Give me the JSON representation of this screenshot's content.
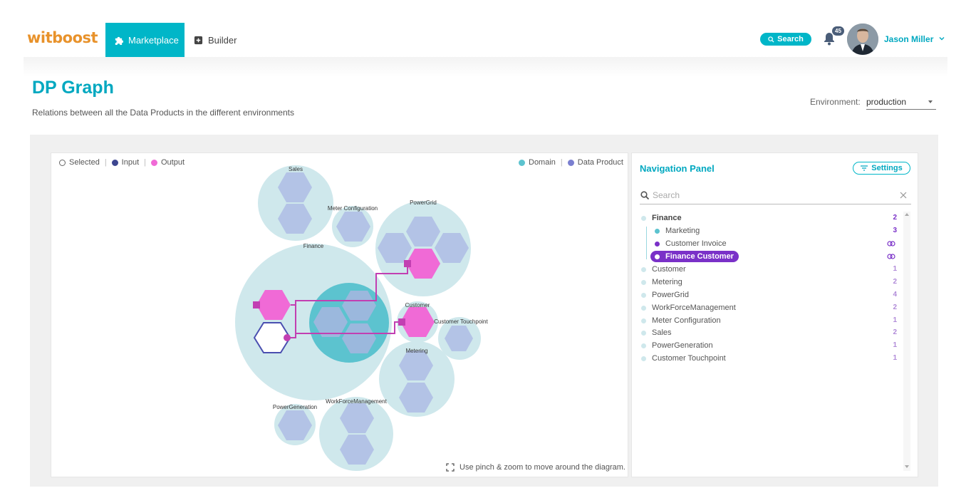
{
  "app": {
    "logo": "witboost",
    "nav": {
      "marketplace": "Marketplace",
      "builder": "Builder"
    },
    "search_button": "Search",
    "notifications_count": "45",
    "user": {
      "name": "Jason Miller"
    }
  },
  "page": {
    "title": "DP Graph",
    "subtitle": "Relations between all the Data Products in the different environments",
    "environment_label": "Environment:",
    "environment_value": "production"
  },
  "graph": {
    "legend_left": {
      "selected": "Selected",
      "input": "Input",
      "output": "Output"
    },
    "legend_right": {
      "domain": "Domain",
      "data_product": "Data Product"
    },
    "domains": {
      "sales": "Sales",
      "meter_configuration": "Meter Configuration",
      "powergrid": "PowerGrid",
      "finance": "Finance",
      "customer": "Customer",
      "customer_touchpoint": "Customer Touchpoint",
      "metering": "Metering",
      "powergeneration": "PowerGeneration",
      "workforcemanagement": "WorkForceManagement"
    },
    "hint": "Use pinch & zoom to move around the diagram.",
    "colors": {
      "domain": "#cfe8ec",
      "domain_selected": "#5cc3cf",
      "data_product": "#b3c3e6",
      "output": "#f06ad6",
      "input": "#4a4fb0",
      "edge": "#c23fb2"
    }
  },
  "navigation_panel": {
    "title": "Navigation Panel",
    "settings_label": "Settings",
    "search_placeholder": "Search",
    "items": [
      {
        "label": "Finance",
        "count": "2"
      },
      {
        "label": "Marketing",
        "count": "3"
      },
      {
        "label": "Customer Invoice",
        "count": ""
      },
      {
        "label": "Finance Customer",
        "count": ""
      },
      {
        "label": "Customer",
        "count": "1"
      },
      {
        "label": "Metering",
        "count": "2"
      },
      {
        "label": "PowerGrid",
        "count": "4"
      },
      {
        "label": "WorkForceManagement",
        "count": "2"
      },
      {
        "label": "Meter Configuration",
        "count": "1"
      },
      {
        "label": "Sales",
        "count": "2"
      },
      {
        "label": "PowerGeneration",
        "count": "1"
      },
      {
        "label": "Customer Touchpoint",
        "count": "1"
      }
    ]
  }
}
